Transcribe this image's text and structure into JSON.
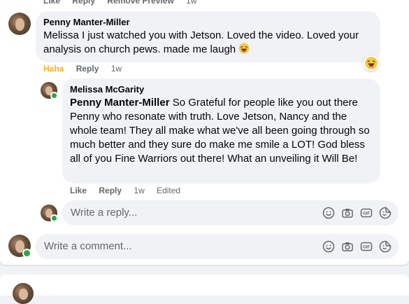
{
  "top_actions": {
    "like": "Like",
    "reply": "Reply",
    "remove_preview": "Remove Preview",
    "time": "1w"
  },
  "comment1": {
    "author": "Penny Manter-Miller",
    "text": "Melissa I just watched you with Jetson. Loved the video. Loved your analysis on church pews. made me laugh",
    "reaction": "Haha",
    "reply": "Reply",
    "time": "1w",
    "reaction_icon": "haha-emoji-icon"
  },
  "reply1": {
    "author": "Melissa McGarity",
    "mention": "Penny Manter-Miller",
    "text": " So Grateful for people like you out there Penny who resonate with truth. Love Jetson, Nancy and the whole team! They all make what we've all been going through so much better and they sure do make me smile a LOT! God bless all of you Fine Warriors out there! What an unveiling it Will Be!",
    "like": "Like",
    "reply": "Reply",
    "time": "1w",
    "edited": "Edited"
  },
  "reply_input": {
    "placeholder": "Write a reply..."
  },
  "comment_input": {
    "placeholder": "Write a comment..."
  },
  "input_icons": [
    "emoji-icon",
    "camera-icon",
    "gif-icon",
    "sticker-icon"
  ],
  "colors": {
    "haha": "#f7b125",
    "online": "#31a24c",
    "bubble": "#f0f2f5",
    "secondary_text": "#65676b"
  }
}
